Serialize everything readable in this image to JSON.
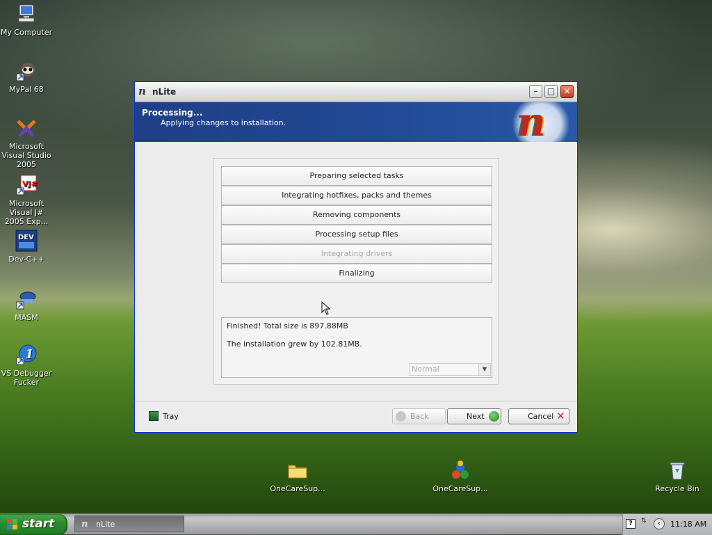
{
  "desktop": {
    "icons": [
      {
        "label": "My Computer"
      },
      {
        "label": "MyPal 68"
      },
      {
        "label": "Microsoft Visual Studio 2005"
      },
      {
        "label": "Microsoft Visual J# 2005 Exp..."
      },
      {
        "label": "Dev-C++"
      },
      {
        "label": "MASM"
      },
      {
        "label": "VS Debugger Fucker"
      },
      {
        "label": "OneCareSup..."
      },
      {
        "label": "OneCareSup..."
      },
      {
        "label": "Recycle Bin"
      }
    ]
  },
  "window": {
    "title": "nLite",
    "header": {
      "title": "Processing...",
      "subtitle": "Applying changes to installation."
    },
    "tasks": [
      {
        "label": "Preparing selected tasks",
        "enabled": true
      },
      {
        "label": "Integrating hotfixes, packs and themes",
        "enabled": true
      },
      {
        "label": "Removing components",
        "enabled": true
      },
      {
        "label": "Processing setup files",
        "enabled": true
      },
      {
        "label": "Integrating drivers",
        "enabled": false
      },
      {
        "label": "Finalizing",
        "enabled": true
      }
    ],
    "result": {
      "line1": "Finished! Total size is 897.88MB",
      "line2": "The installation grew by 102.81MB."
    },
    "priority_select": {
      "value": "Normal"
    },
    "buttons": {
      "tray": "Tray",
      "back": "Back",
      "next": "Next",
      "cancel": "Cancel"
    }
  },
  "taskbar": {
    "start_label": "start",
    "tasks": [
      {
        "label": "nLite"
      }
    ],
    "tray": {
      "clock": "11:18 AM"
    }
  },
  "colors": {
    "header_band": "#224a96",
    "start_green": "#2f8d2f",
    "close_red": "#c43b1a"
  }
}
